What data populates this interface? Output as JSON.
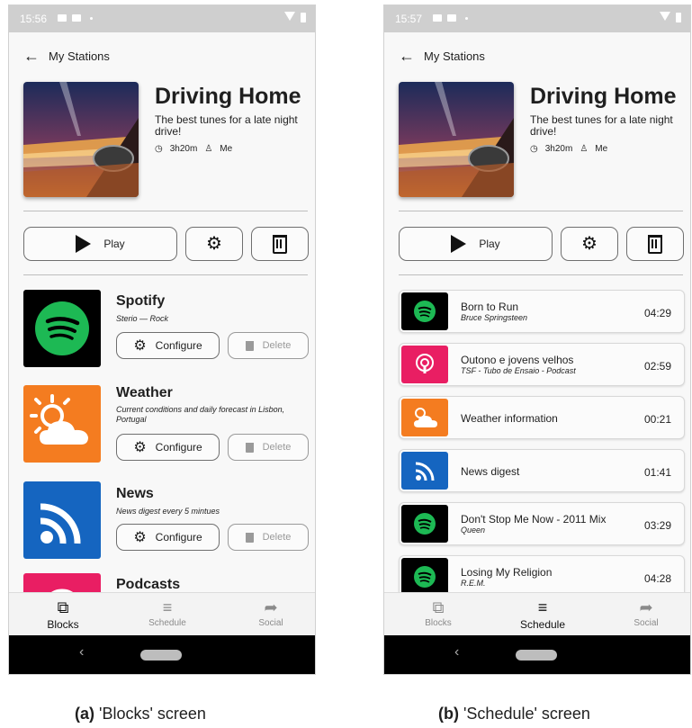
{
  "blocks_screen": {
    "status": {
      "time": "15:56"
    },
    "back_label": "My Stations",
    "station": {
      "title": "Driving Home",
      "description": "The best tunes for a late night drive!",
      "duration": "3h20m",
      "owner": "Me"
    },
    "play_label": "Play",
    "blocks": [
      {
        "name": "Spotify",
        "subtitle": "Sterio — Rock",
        "configure": "Configure",
        "delete": "Delete"
      },
      {
        "name": "Weather",
        "subtitle": "Current conditions and daily forecast in Lisbon, Portugal",
        "configure": "Configure",
        "delete": "Delete"
      },
      {
        "name": "News",
        "subtitle": "News digest every 5 mintues",
        "configure": "Configure",
        "delete": "Delete"
      },
      {
        "name": "Podcasts"
      }
    ],
    "nav": [
      {
        "label": "Blocks",
        "active": true
      },
      {
        "label": "Schedule",
        "active": false
      },
      {
        "label": "Social",
        "active": false
      }
    ]
  },
  "schedule_screen": {
    "status": {
      "time": "15:57"
    },
    "back_label": "My Stations",
    "station": {
      "title": "Driving Home",
      "description": "The best tunes for a late night drive!",
      "duration": "3h20m",
      "owner": "Me"
    },
    "play_label": "Play",
    "items": [
      {
        "title": "Born to Run",
        "subtitle": "Bruce Springsteen",
        "duration": "04:29",
        "icon": "spotify-icon"
      },
      {
        "title": "Outono e jovens velhos",
        "subtitle": "TSF - Tubo de Ensaio - Podcast",
        "duration": "02:59",
        "icon": "podcast-icon"
      },
      {
        "title": "Weather information",
        "duration": "00:21",
        "icon": "weather-icon"
      },
      {
        "title": "News digest",
        "duration": "01:41",
        "icon": "rss-icon"
      },
      {
        "title": "Don't Stop Me Now - 2011 Mix",
        "subtitle": "Queen",
        "duration": "03:29",
        "icon": "spotify-icon"
      },
      {
        "title": "Losing My Religion",
        "subtitle": "R.E.M.",
        "duration": "04:28",
        "icon": "spotify-icon"
      }
    ],
    "nav": [
      {
        "label": "Blocks",
        "active": false
      },
      {
        "label": "Schedule",
        "active": true
      },
      {
        "label": "Social",
        "active": false
      }
    ]
  },
  "captions": {
    "a_tag": "(a)",
    "a_text": " 'Blocks' screen",
    "b_tag": "(b)",
    "b_text": " 'Schedule' screen"
  },
  "colors": {
    "spotify_bg": "#000000",
    "spotify_green": "#1db954",
    "weather_bg": "#f47c20",
    "news_bg": "#1565c0",
    "podcast_bg": "#e91e63"
  }
}
